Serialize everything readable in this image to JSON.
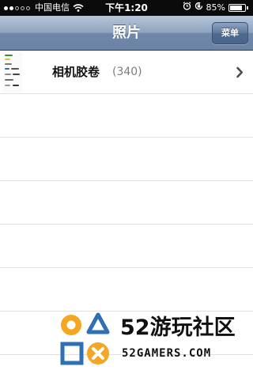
{
  "status_bar": {
    "carrier": "中国电信",
    "time": "下午1:20",
    "battery_percent": "85%",
    "battery_level": 0.85,
    "signal_bars_filled": 2,
    "signal_bars_total": 5,
    "icons": [
      "signal-icon",
      "wifi-icon",
      "alarm-icon",
      "lock-rotation-icon",
      "battery-icon"
    ]
  },
  "nav": {
    "title": "照片",
    "menu_button": "菜单"
  },
  "albums": [
    {
      "name": "相机胶卷",
      "count": "(340)",
      "icon": "chevron-right-icon"
    }
  ],
  "watermark": {
    "title": "52游玩社区",
    "subtitle": "52GAMERS.COM"
  },
  "colors": {
    "status_bar_bg": "#0b0b0b",
    "nav_bar_top": "#b7c5d8",
    "nav_bar_bottom": "#6b84a6",
    "separator": "#e0e0e0",
    "count_gray": "#7d7d7d",
    "watermark_orange": "#f5a623",
    "watermark_blue": "#2f6fb5"
  }
}
